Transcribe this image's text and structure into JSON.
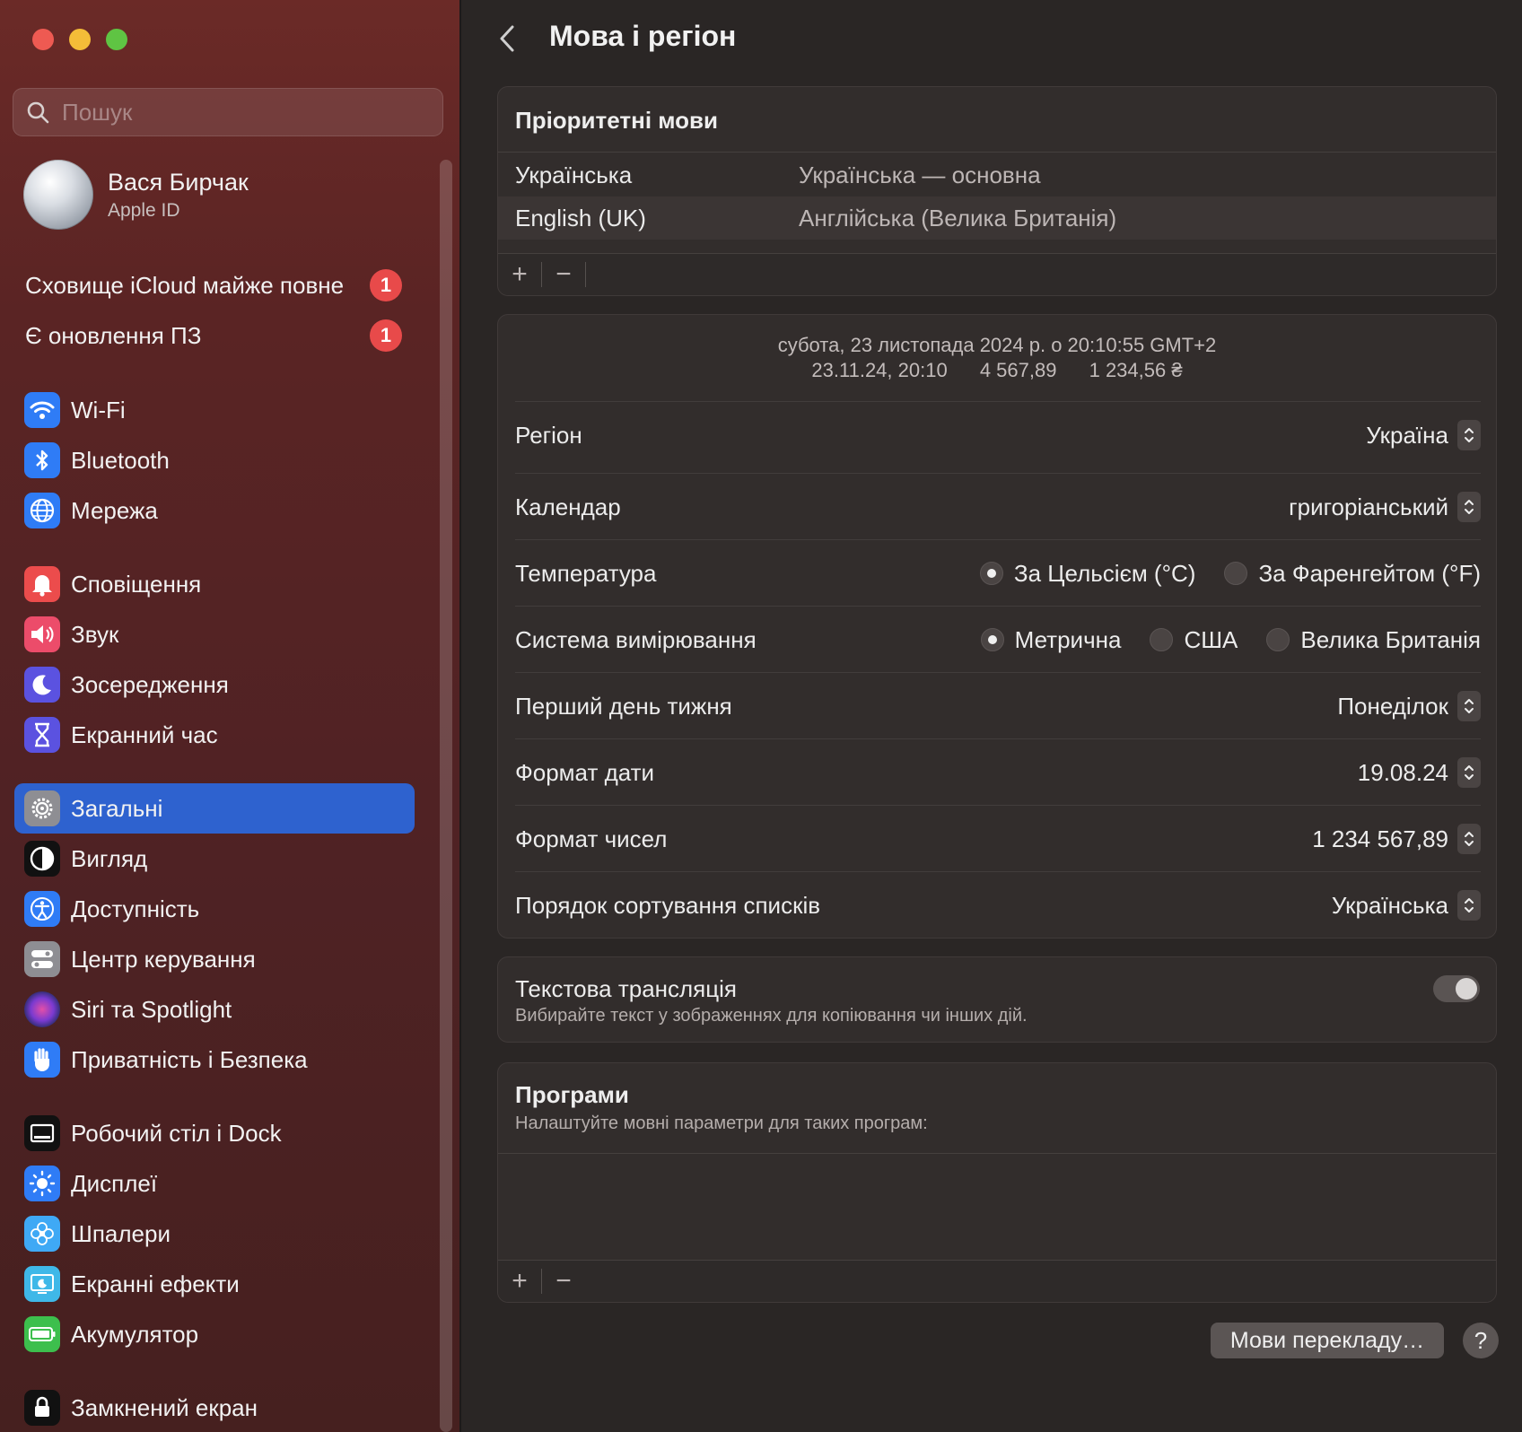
{
  "window": {
    "title": "Мова і регіон"
  },
  "sidebar": {
    "search_placeholder": "Пошук",
    "profile": {
      "name": "Вася Бирчак",
      "subtitle": "Apple ID"
    },
    "alerts": [
      {
        "label": "Сховище iCloud майже повне",
        "badge": "1"
      },
      {
        "label": "Є оновлення ПЗ",
        "badge": "1"
      }
    ],
    "items": [
      {
        "label": "Wi-Fi",
        "icon": "wifi-icon",
        "color": "#2f7cf6"
      },
      {
        "label": "Bluetooth",
        "icon": "bluetooth-icon",
        "color": "#2f7cf6"
      },
      {
        "label": "Мережа",
        "icon": "globe-icon",
        "color": "#2f7cf6"
      },
      {
        "label": "Сповіщення",
        "icon": "bell-icon",
        "color": "#ec4c4c"
      },
      {
        "label": "Звук",
        "icon": "speaker-icon",
        "color": "#ec4c6a"
      },
      {
        "label": "Зосередження",
        "icon": "moon-icon",
        "color": "#5b52e0"
      },
      {
        "label": "Екранний час",
        "icon": "hourglass-icon",
        "color": "#5b52e0"
      },
      {
        "label": "Загальні",
        "icon": "gear-icon",
        "color": "#8e8e93"
      },
      {
        "label": "Вигляд",
        "icon": "appearance-icon",
        "color": "#111111"
      },
      {
        "label": "Доступність",
        "icon": "accessibility-icon",
        "color": "#2f7cf6"
      },
      {
        "label": "Центр керування",
        "icon": "control-center-icon",
        "color": "#8e8e93"
      },
      {
        "label": "Siri та Spotlight",
        "icon": "siri-icon",
        "color": "#7a3ad0"
      },
      {
        "label": "Приватність і Безпека",
        "icon": "hand-icon",
        "color": "#2f7cf6"
      },
      {
        "label": "Робочий стіл і Dock",
        "icon": "dock-icon",
        "color": "#111111"
      },
      {
        "label": "Дисплеї",
        "icon": "sun-icon",
        "color": "#2f7cf6"
      },
      {
        "label": "Шпалери",
        "icon": "flower-icon",
        "color": "#3fa9f5"
      },
      {
        "label": "Екранні ефекти",
        "icon": "screensaver-icon",
        "color": "#3fb8e8"
      },
      {
        "label": "Акумулятор",
        "icon": "battery-icon",
        "color": "#3dbf4d"
      },
      {
        "label": "Замкнений екран",
        "icon": "lock-icon",
        "color": "#111111"
      }
    ],
    "selected_index": 7
  },
  "main": {
    "languages": {
      "title": "Пріоритетні мови",
      "rows": [
        {
          "name": "Українська",
          "desc": "Українська — основна"
        },
        {
          "name": "English (UK)",
          "desc": "Англійська (Велика Британія)"
        }
      ],
      "add": "+",
      "remove": "−"
    },
    "region": {
      "preview_line1": "субота, 23 листопада 2024 р. о 20:10:55 GMT+2",
      "preview_date": "23.11.24, 20:10",
      "preview_number": "4 567,89",
      "preview_currency": "1 234,56 ₴",
      "region_label": "Регіон",
      "region_value": "Україна",
      "calendar_label": "Календар",
      "calendar_value": "григоріанський",
      "temperature_label": "Температура",
      "temperature_options": [
        "За Цельсієм (°C)",
        "За Фаренгейтом (°F)"
      ],
      "temperature_selected": 0,
      "measure_label": "Система вимірювання",
      "measure_options": [
        "Метрична",
        "США",
        "Велика Британія"
      ],
      "measure_selected": 0,
      "first_day_label": "Перший день тижня",
      "first_day_value": "Понеділок",
      "date_format_label": "Формат дати",
      "date_format_value": "19.08.24",
      "number_format_label": "Формат чисел",
      "number_format_value": "1 234 567,89",
      "sort_label": "Порядок сортування списків",
      "sort_value": "Українська"
    },
    "live_text": {
      "title": "Текстова трансляція",
      "subtitle": "Вибирайте текст у зображеннях для копіювання чи інших дій.",
      "enabled": false
    },
    "apps": {
      "title": "Програми",
      "subtitle": "Налаштуйте мовні параметри для таких програм:",
      "add": "+",
      "remove": "−"
    },
    "translate_button": "Мови перекладу…",
    "help_button": "?"
  }
}
